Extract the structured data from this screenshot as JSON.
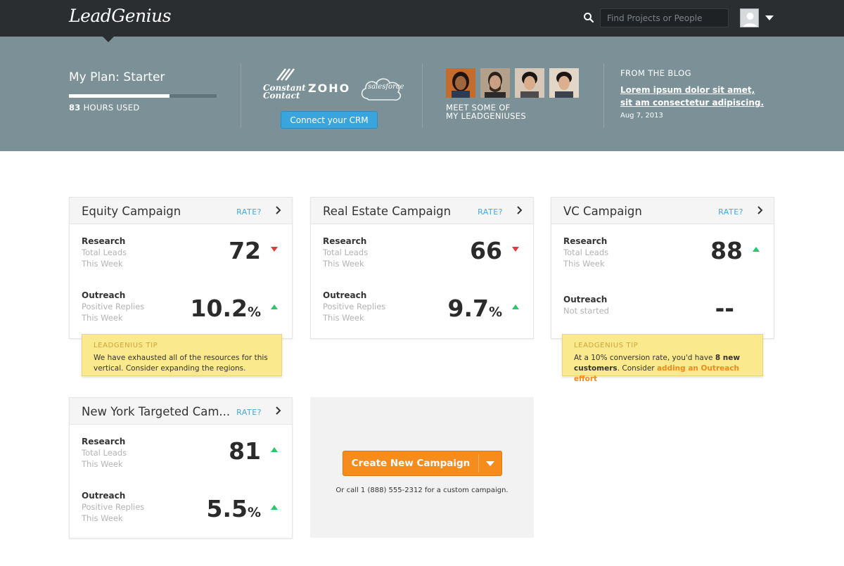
{
  "brand": {
    "logo_text": "LeadGenius"
  },
  "topbar": {
    "search_placeholder": "Find Projects or People",
    "search_icon": "search-icon",
    "avatar_icon": "user-avatar",
    "menu_icon": "caret-down-icon"
  },
  "plan": {
    "title": "My Plan: Starter",
    "hours_value": "83",
    "hours_label": "HOURS USED",
    "usage_fraction": 0.68
  },
  "crm": {
    "logos": [
      "Constant Contact",
      "ZOHO",
      "salesforce"
    ],
    "constant_contact_line1": "Constant",
    "constant_contact_line2": "Contact",
    "zoho": "ZOHO",
    "salesforce": "salesforce",
    "button_label": "Connect your CRM"
  },
  "team": {
    "caption_line1": "MEET SOME OF",
    "caption_line2": "MY LEADGENIUSES",
    "photo_count": 4
  },
  "blog": {
    "eyebrow": "FROM THE BLOG",
    "title": "Lorem ipsum dolor sit amet, sit am consectetur adipiscing.",
    "date": "Aug 7, 2013"
  },
  "rate_label": "RATE?",
  "campaigns": [
    {
      "title": "Equity Campaign",
      "research": {
        "label": "Research",
        "sub1": "Total Leads",
        "sub2": "This Week",
        "value": "72",
        "trend": "down"
      },
      "outreach": {
        "label": "Outreach",
        "sub1": "Positive Replies",
        "sub2": "This Week",
        "value": "10.2",
        "unit": "%",
        "trend": "up"
      }
    },
    {
      "title": "Real Estate Campaign",
      "research": {
        "label": "Research",
        "sub1": "Total Leads",
        "sub2": "This Week",
        "value": "66",
        "trend": "down"
      },
      "outreach": {
        "label": "Outreach",
        "sub1": "Positive Replies",
        "sub2": "This Week",
        "value": "9.7",
        "unit": "%",
        "trend": "up"
      }
    },
    {
      "title": "VC Campaign",
      "research": {
        "label": "Research",
        "sub1": "Total Leads",
        "sub2": "This Week",
        "value": "88",
        "trend": "up"
      },
      "outreach": {
        "label": "Outreach",
        "sub1": "Not started",
        "value": "--"
      }
    },
    {
      "title": "New York Targeted Cam...",
      "research": {
        "label": "Research",
        "sub1": "Total Leads",
        "sub2": "This Week",
        "value": "81",
        "trend": "up"
      },
      "outreach": {
        "label": "Outreach",
        "sub1": "Positive Replies",
        "sub2": "This Week",
        "value": "5.5",
        "unit": "%",
        "trend": "up"
      }
    }
  ],
  "tips": [
    {
      "heading": "LEADGENIUS TIP",
      "body": "We have exhausted all of the resources for this vertical. Consider expanding the regions."
    },
    {
      "heading": "LEADGENIUS TIP",
      "body_pre": "At a 10% conversion rate, you'd have ",
      "body_bold": "8 new customers",
      "body_mid": ". Consider ",
      "body_link": "adding an Outreach effort"
    }
  ],
  "create": {
    "button_label": "Create New Campaign",
    "note": "Or call 1 (888) 555-2312 for a custom campaign."
  },
  "colors": {
    "topbar": "#2b2e31",
    "band": "#7b9197",
    "accent_blue": "#3aa4dd",
    "accent_orange": "#f58c1c",
    "trend_up": "#2ec56b",
    "trend_down": "#e0393e",
    "tip_bg": "#fbe98d"
  }
}
